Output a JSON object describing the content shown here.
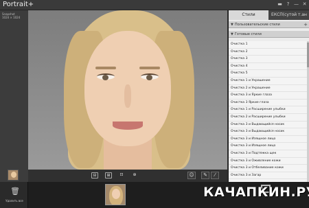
{
  "app": {
    "title": "Portrait+"
  },
  "window_controls": [
    "▬",
    "?",
    "—",
    "✕"
  ],
  "left_panel": {
    "info_line1": "Snapshot",
    "info_line2": "1024 × 1024"
  },
  "tabs": {
    "active": "Стили",
    "inactive": "ЕКСП(сутой т.ан"
  },
  "sections": {
    "user_styles": "Пользовательские стили",
    "ready_styles": "Готовые стили",
    "user_plus": "+"
  },
  "styles": [
    "Очистка 1",
    "Очистка 2",
    "Очистка 3",
    "Очистка 4",
    "Очистка 5",
    "Очистка 1 и Украшение",
    "Очистка 2 и Украшение",
    "Очистка 3 и Яркие глаза",
    "Очистка 3 Яркие глаза",
    "Очистка 1 и Расширение улыбки",
    "Очистка 2 и Расширение улыбки",
    "Очистка 3 и Выдающийся носик",
    "Очистка 3 и Выдающийся носик",
    "Очистка 3 и Изящное лицо",
    "Очистка 3 и Изящное лицо",
    "Очистка 3 и Подтяжка щек",
    "Очистка 3 и Оживление кожи",
    "Очистка 3 и Отбеливание кожи",
    "Очистка 3 и Загар"
  ],
  "toolbar": {
    "tools": [
      "⊟",
      "⊞",
      "⊡",
      "⊕"
    ],
    "right_tools": [
      "☺",
      "✎",
      "⁄"
    ]
  },
  "bottom": {
    "trash_label": "Удалить все",
    "trash_icon": "🗑"
  },
  "watermark": {
    "text": "КАЧАПКИН.РУ"
  },
  "colors": {
    "panel_bg": "#ececec",
    "titlebar": "#3a3a3a",
    "photo_bg": "#8c8c8c"
  }
}
